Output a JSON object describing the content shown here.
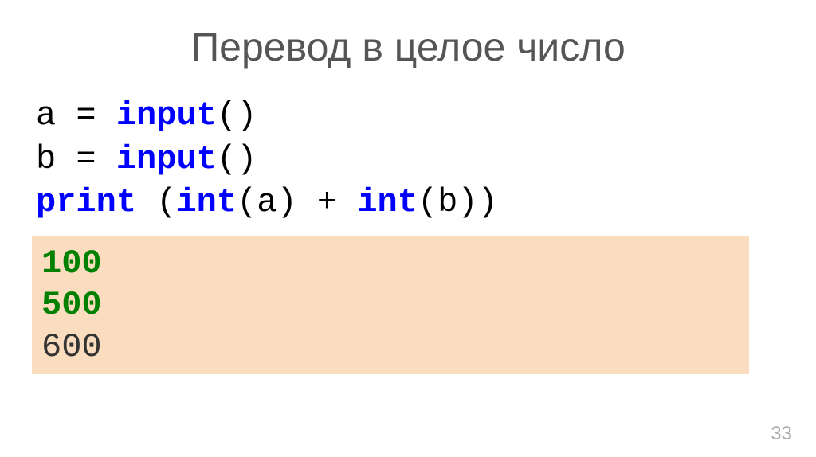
{
  "title": "Перевод в целое число",
  "code": {
    "line1": {
      "var": "a = ",
      "func": "input",
      "parens": "()"
    },
    "line2": {
      "var": "b = ",
      "func": "input",
      "parens": "()"
    },
    "line3": {
      "print": "print",
      "space_open": " (",
      "int1": "int",
      "arg1": "(a) + ",
      "int2": "int",
      "arg2": "(b))"
    }
  },
  "output": {
    "line1": "100",
    "line2": "500",
    "line3": "600"
  },
  "page_number": "33"
}
